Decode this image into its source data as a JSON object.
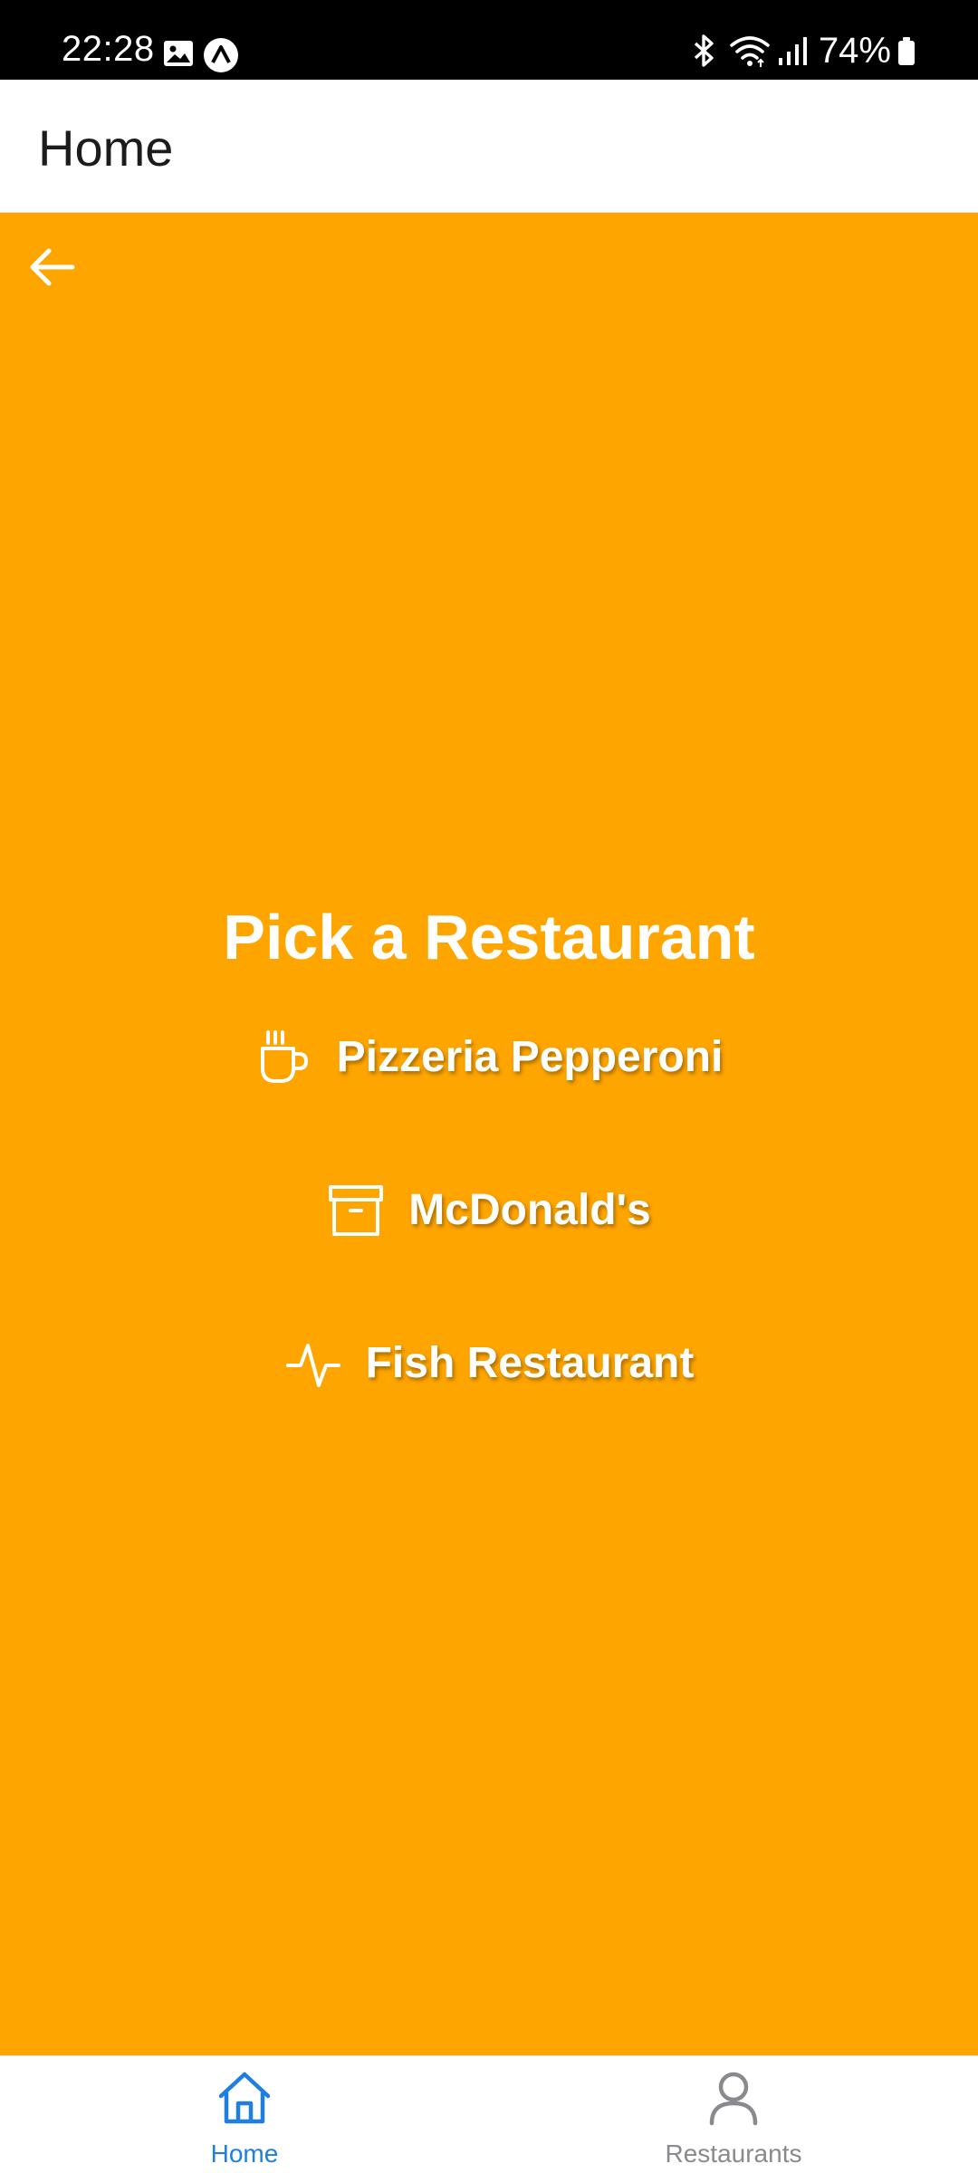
{
  "status_bar": {
    "time": "22:28",
    "battery_percent": "74%",
    "icons": [
      "image-icon",
      "app-notification-icon",
      "bluetooth-icon",
      "wifi-icon",
      "signal-icon",
      "battery-icon"
    ]
  },
  "header": {
    "title": "Home"
  },
  "main": {
    "background_color": "#FFA500",
    "heading": "Pick a Restaurant",
    "restaurants": [
      {
        "label": "Pizzeria Pepperoni",
        "icon": "coffee-cup-icon"
      },
      {
        "label": "McDonald's",
        "icon": "archive-box-icon"
      },
      {
        "label": "Fish Restaurant",
        "icon": "activity-pulse-icon"
      }
    ]
  },
  "bottom_nav": {
    "tabs": [
      {
        "label": "Home",
        "icon": "home-icon",
        "active": true
      },
      {
        "label": "Restaurants",
        "icon": "user-icon",
        "active": false
      }
    ],
    "active_color": "#1F7FE0",
    "inactive_color": "#8a8a8e"
  }
}
